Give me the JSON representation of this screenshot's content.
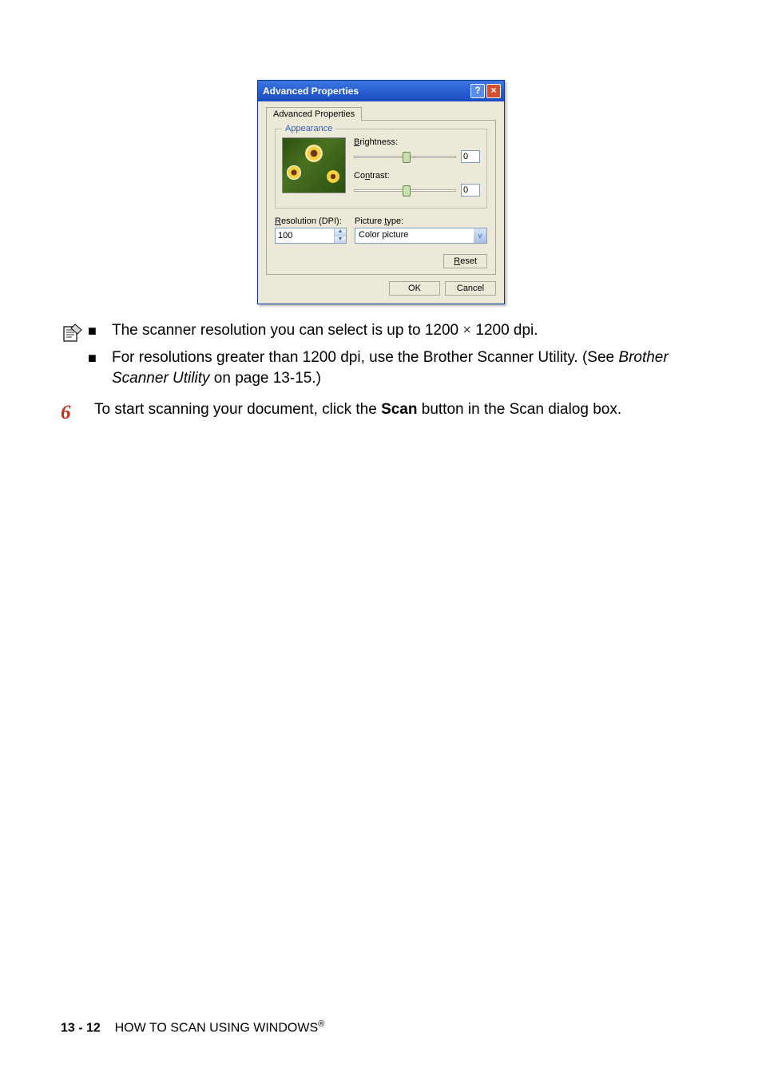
{
  "dialog": {
    "title": "Advanced Properties",
    "tab": "Advanced Properties",
    "appearance": {
      "legend": "Appearance",
      "brightness_label": "Brightness:",
      "brightness_value": "0",
      "contrast_label": "Contrast:",
      "contrast_value": "0"
    },
    "resolution": {
      "label": "Resolution (DPI):",
      "value": "100"
    },
    "picture_type": {
      "label": "Picture type:",
      "value": "Color picture"
    },
    "reset_label": "Reset",
    "ok_label": "OK",
    "cancel_label": "Cancel"
  },
  "notes": {
    "item1_a": "The scanner resolution you can select is up to 1200 ",
    "item1_b": " 1200 dpi.",
    "times": "×",
    "item2_a": "For resolutions greater than 1200 dpi, use the Brother Scanner Utility. (See ",
    "item2_ref": "Brother Scanner Utility",
    "item2_b": " on page 13-15.)"
  },
  "step": {
    "number": "6",
    "text_a": "To start scanning your document, click the ",
    "text_bold": "Scan",
    "text_b": " button in the Scan dialog box."
  },
  "footer": {
    "page": "13 - 12",
    "title": "HOW TO SCAN USING WINDOWS",
    "reg": "®"
  }
}
